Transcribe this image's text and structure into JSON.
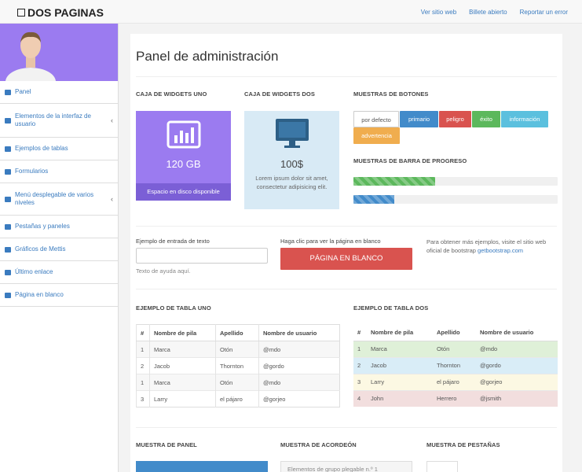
{
  "navbar": {
    "brand": "DOS PAGINAS",
    "links": [
      "Ver sitio web",
      "Billete abierto",
      "Reportar un error"
    ]
  },
  "sidebar": {
    "items": [
      {
        "label": "Panel",
        "icon": "desktop-icon",
        "chevron": ""
      },
      {
        "label": "Elementos de la interfaz de usuario",
        "icon": "edit-icon",
        "chevron": "‹"
      },
      {
        "label": "Ejemplos de tablas",
        "icon": "table-icon",
        "chevron": ""
      },
      {
        "label": "Formularios",
        "icon": "edit-icon",
        "chevron": ""
      },
      {
        "label": "Menú desplegable de varios niveles",
        "icon": "sitemap-icon",
        "chevron": "‹"
      },
      {
        "label": "Pestañas y paneles",
        "icon": "list-icon",
        "chevron": ""
      },
      {
        "label": "Gráficos de Mettis",
        "icon": "chart-icon",
        "chevron": ""
      },
      {
        "label": "Último enlace",
        "icon": "edit-icon",
        "chevron": ""
      },
      {
        "label": "Página en blanco",
        "icon": "table-icon",
        "chevron": ""
      }
    ]
  },
  "main": {
    "title": "Panel de administración",
    "widget_one": {
      "section": "CAJA DE WIDGETS UNO",
      "value": "120 GB",
      "footer": "Espacio en disco disponible",
      "icon": "bar-chart-icon"
    },
    "widget_two": {
      "section": "CAJA DE WIDGETS DOS",
      "value": "100$",
      "desc": "Lorem ipsum dolor sit amet, consectetur adipisicing elit.",
      "icon": "monitor-icon"
    },
    "buttons": {
      "section": "MUESTRAS DE BOTONES",
      "default": "por defecto",
      "primary": "primario",
      "danger": "peligro",
      "success": "éxito",
      "info": "información",
      "warning": "advertencia"
    },
    "progress": {
      "section": "MUESTRAS DE BARRA DE PROGRESO",
      "bar1_value": 40,
      "bar2_value": 20,
      "bar1_color": "#5cb85c",
      "bar2_color": "#428bca"
    },
    "text_input": {
      "label": "Ejemplo de entrada de texto",
      "help": "Texto de ayuda aquí."
    },
    "blank_page": {
      "label": "Haga clic para ver la página en blanco",
      "button": "PÁGINA EN BLANCO"
    },
    "more_info": {
      "text": "Para obtener más ejemplos, visite el sitio web oficial de bootstrap ",
      "link": "getbootstrap.com"
    },
    "table_one": {
      "section": "EJEMPLO DE TABLA UNO",
      "headers": [
        "#",
        "Nombre de pila",
        "Apellido",
        "Nombre de usuario"
      ],
      "rows": [
        [
          "1",
          "Marca",
          "Otón",
          "@mdo"
        ],
        [
          "2",
          "Jacob",
          "Thornton",
          "@gordo"
        ],
        [
          "1",
          "Marca",
          "Otón",
          "@mdo"
        ],
        [
          "3",
          "Larry",
          "el pájaro",
          "@gorjeo"
        ]
      ]
    },
    "table_two": {
      "section": "EJEMPLO DE TABLA DOS",
      "headers": [
        "#",
        "Nombre de pila",
        "Apellido",
        "Nombre de usuario"
      ],
      "rows": [
        [
          "1",
          "Marca",
          "Otón",
          "@mdo"
        ],
        [
          "2",
          "Jacob",
          "Thornton",
          "@gordo"
        ],
        [
          "3",
          "Larry",
          "el pájaro",
          "@gorjeo"
        ],
        [
          "4",
          "John",
          "Herrero",
          "@jsmith"
        ]
      ]
    },
    "bottom": {
      "panel": "MUESTRA DE PANEL",
      "accordion": "MUESTRA DE ACORDEÓN",
      "tabs": "MUESTRA DE PESTAÑAS",
      "accordion_item": "Elementos de grupo plegable n.º 1"
    }
  }
}
